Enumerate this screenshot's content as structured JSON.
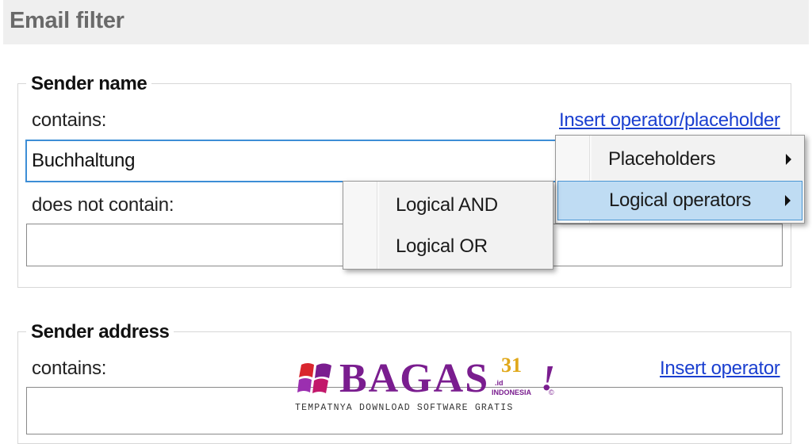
{
  "header": {
    "title": "Email filter"
  },
  "sender_name": {
    "legend": "Sender name",
    "contains_label": "contains:",
    "insert_link": "Insert operator/placeholder",
    "contains_value": "Buchhaltung",
    "not_contains_label": "does not contain:",
    "not_contains_value": ""
  },
  "sender_address": {
    "legend": "Sender address",
    "contains_label": "contains:",
    "insert_link": "Insert operator",
    "contains_value": ""
  },
  "context_menu": {
    "items": [
      {
        "label": "Placeholders",
        "has_submenu": true,
        "highlighted": false
      },
      {
        "label": "Logical operators",
        "has_submenu": true,
        "highlighted": true
      }
    ]
  },
  "submenu": {
    "items": [
      {
        "label": "Logical AND"
      },
      {
        "label": "Logical OR"
      }
    ]
  },
  "watermark": {
    "brand": "BAGAS",
    "number": "31",
    "exclamation": "!",
    "domain_suffix": ".id",
    "country": "INDONESIA",
    "copyright": "©",
    "tagline": "TEMPATNYA DOWNLOAD SOFTWARE GRATIS"
  },
  "colors": {
    "link": "#1a3fd0",
    "focus_border": "#3d8ed6",
    "menu_highlight": "#bfdcf3",
    "watermark_brand": "#7a1d8f",
    "watermark_number": "#e0a81a"
  }
}
